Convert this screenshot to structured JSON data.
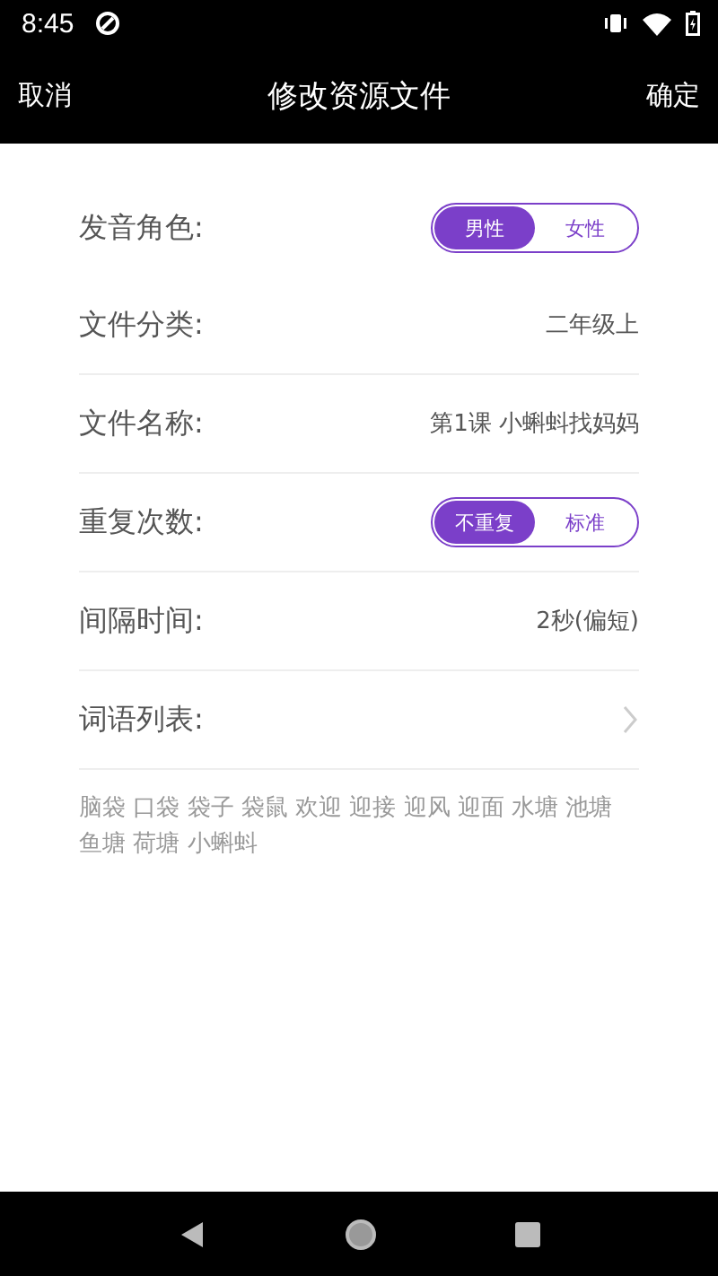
{
  "status_bar": {
    "time": "8:45"
  },
  "app_bar": {
    "left": "取消",
    "title": "修改资源文件",
    "right": "确定"
  },
  "rows": [
    {
      "kind": "toggle",
      "label": "发音角色:",
      "options": [
        {
          "label": "男性",
          "selected": true
        },
        {
          "label": "女性",
          "selected": false
        }
      ]
    },
    {
      "kind": "value",
      "label": "文件分类:",
      "value": "二年级上"
    },
    {
      "kind": "value",
      "label": "文件名称:",
      "value": "第1课 小蝌蚪找妈妈"
    },
    {
      "kind": "toggle",
      "label": "重复次数:",
      "options": [
        {
          "label": "不重复",
          "selected": true
        },
        {
          "label": "标准",
          "selected": false
        }
      ]
    },
    {
      "kind": "value",
      "label": "间隔时间:",
      "value": "2秒(偏短)"
    },
    {
      "kind": "link",
      "label": "词语列表:"
    }
  ],
  "word_lines": [
    "脑袋 口袋 袋子 袋鼠 欢迎 迎接 迎风 迎面 水塘 池塘",
    "鱼塘 荷塘 小蝌蚪"
  ]
}
